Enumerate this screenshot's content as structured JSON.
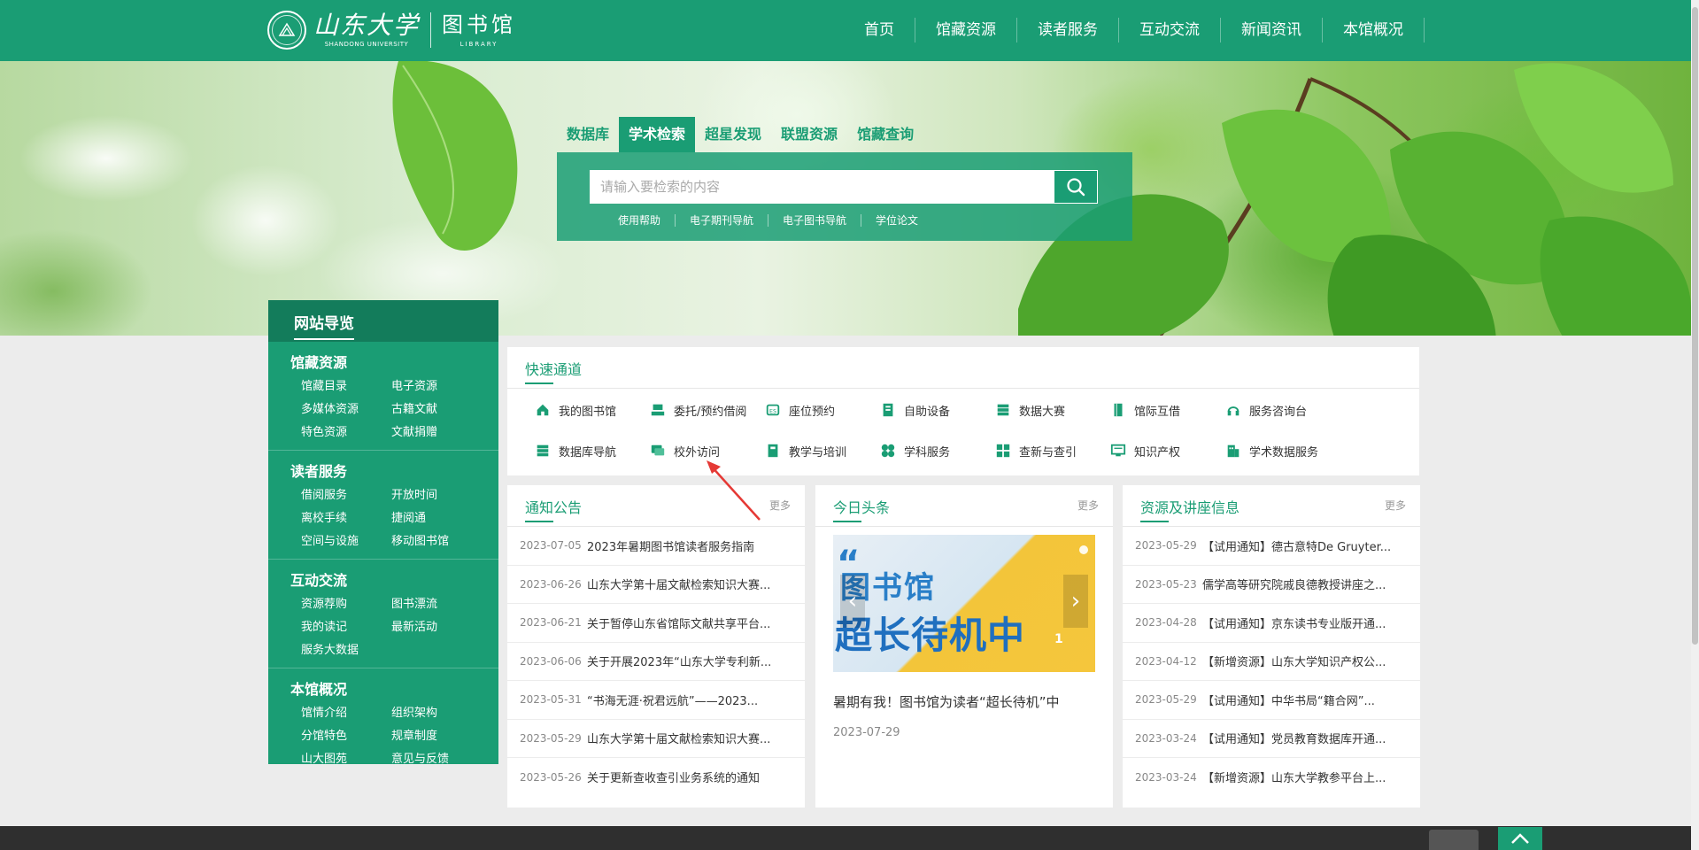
{
  "header": {
    "logo_cn": "山东大学",
    "logo_en": "SHANDONG UNIVERSITY",
    "logo_lib_cn": "图书馆",
    "logo_lib_en": "LIBRARY",
    "nav": [
      "首页",
      "馆藏资源",
      "读者服务",
      "互动交流",
      "新闻资讯",
      "本馆概况"
    ]
  },
  "search": {
    "tabs": [
      "数据库",
      "学术检索",
      "超星发现",
      "联盟资源",
      "馆藏查询"
    ],
    "active_tab": "学术检索",
    "placeholder": "请输入要检索的内容",
    "links": [
      "使用帮助",
      "电子期刊导航",
      "电子图书导航",
      "学位论文"
    ]
  },
  "sidebar": {
    "title": "网站导览",
    "groups": [
      {
        "title": "馆藏资源",
        "items": [
          "馆藏目录",
          "电子资源",
          "多媒体资源",
          "古籍文献",
          "特色资源",
          "文献捐赠"
        ]
      },
      {
        "title": "读者服务",
        "items": [
          "借阅服务",
          "开放时间",
          "离校手续",
          "捷阅通",
          "空间与设施",
          "移动图书馆"
        ]
      },
      {
        "title": "互动交流",
        "items": [
          "资源荐购",
          "图书漂流",
          "我的读记",
          "最新活动",
          "服务大数据"
        ]
      },
      {
        "title": "本馆概况",
        "items": [
          "馆情介绍",
          "组织架构",
          "分馆特色",
          "规章制度",
          "山大图苑",
          "意见与反馈"
        ]
      }
    ]
  },
  "quick": {
    "title": "快速通道",
    "items": [
      {
        "label": "我的图书馆",
        "icon": "home-icon"
      },
      {
        "label": "委托/预约借阅",
        "icon": "stamp-icon"
      },
      {
        "label": "座位预约",
        "icon": "seat-icon"
      },
      {
        "label": "自助设备",
        "icon": "device-icon"
      },
      {
        "label": "数据大赛",
        "icon": "server-icon"
      },
      {
        "label": "馆际互借",
        "icon": "book-icon"
      },
      {
        "label": "服务咨询台",
        "icon": "headset-icon"
      },
      {
        "label": "数据库导航",
        "icon": "database-icon"
      },
      {
        "label": "校外访问",
        "icon": "chat-icon"
      },
      {
        "label": "教学与培训",
        "icon": "teach-icon"
      },
      {
        "label": "学科服务",
        "icon": "clover-icon"
      },
      {
        "label": "查新与查引",
        "icon": "grid-icon"
      },
      {
        "label": "知识产权",
        "icon": "monitor-icon"
      },
      {
        "label": "学术数据服务",
        "icon": "building-icon"
      }
    ]
  },
  "notices": {
    "title": "通知公告",
    "more": "更多",
    "items": [
      {
        "date": "2023-07-05",
        "text": "2023年暑期图书馆读者服务指南"
      },
      {
        "date": "2023-06-26",
        "text": "山东大学第十届文献检索知识大赛..."
      },
      {
        "date": "2023-06-21",
        "text": "关于暂停山东省馆际文献共享平台..."
      },
      {
        "date": "2023-06-06",
        "text": "关于开展2023年“山东大学专利新..."
      },
      {
        "date": "2023-05-31",
        "text": "“书海无涯·祝君远航”——2023..."
      },
      {
        "date": "2023-05-29",
        "text": "山东大学第十届文献检索知识大赛..."
      },
      {
        "date": "2023-05-26",
        "text": "关于更新查收查引业务系统的通知"
      }
    ]
  },
  "headline": {
    "title": "今日头条",
    "more": "更多",
    "img_line1": "图书馆",
    "img_line2": "超长待机中",
    "slide_num": "1",
    "news_title": "暑期有我！图书馆为读者“超长待机”中",
    "news_date": "2023-07-29"
  },
  "resources": {
    "title": "资源及讲座信息",
    "more": "更多",
    "items": [
      {
        "date": "2023-05-29",
        "text": "【试用通知】德古意特De Gruyter..."
      },
      {
        "date": "2023-05-23",
        "text": "儒学高等研究院戚良德教授讲座之..."
      },
      {
        "date": "2023-04-28",
        "text": "【试用通知】京东读书专业版开通..."
      },
      {
        "date": "2023-04-12",
        "text": "【新增资源】山东大学知识产权公..."
      },
      {
        "date": "2023-05-29",
        "text": "【试用通知】中华书局“籍合网”..."
      },
      {
        "date": "2023-03-24",
        "text": "【试用通知】党员教育数据库开通..."
      },
      {
        "date": "2023-03-24",
        "text": "【新增资源】山东大学教参平台上..."
      }
    ]
  },
  "colors": {
    "brand": "#1a9d74",
    "brand_dark": "#137c5b",
    "annotation": "#e53935"
  }
}
